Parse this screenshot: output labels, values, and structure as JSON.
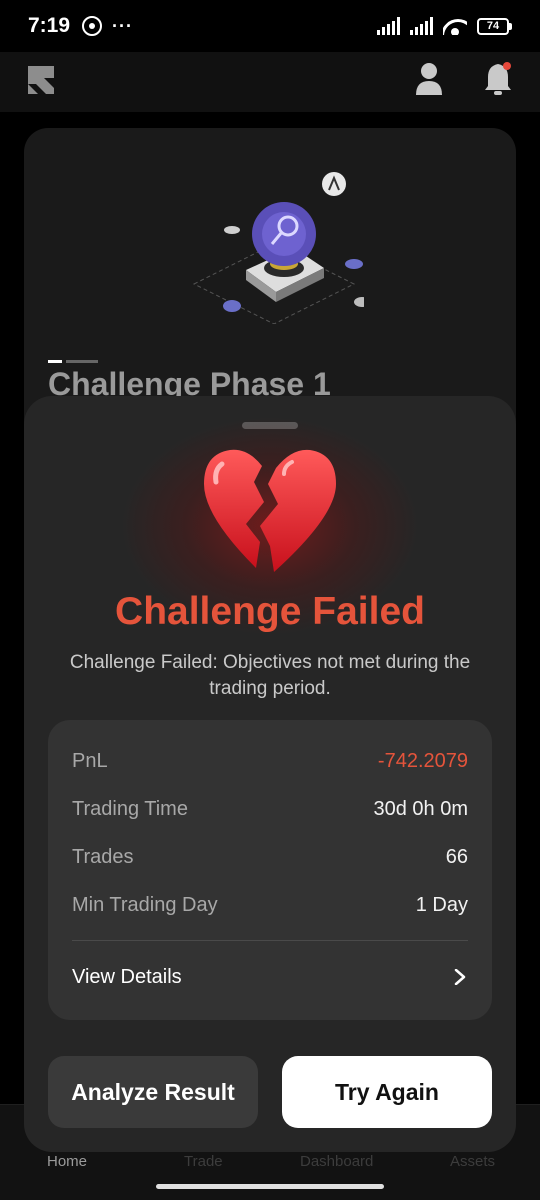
{
  "status_bar": {
    "time": "7:19",
    "more": "···",
    "battery": "74"
  },
  "icons": {
    "logo": "brand-logo",
    "profile": "profile-icon",
    "notifications": "bell-icon",
    "notification_dot_color": "#e5483b"
  },
  "background_card": {
    "title": "Challenge Phase 1"
  },
  "nav": {
    "home": "Home",
    "trade": "Trade",
    "dashboard": "Dashboard",
    "assets": "Assets"
  },
  "sheet": {
    "emoji": "broken-heart-icon",
    "title": "Challenge Failed",
    "description": "Challenge Failed: Objectives not met during the trading period.",
    "stats": [
      {
        "label": "PnL",
        "value": "-742.2079",
        "negative": true
      },
      {
        "label": "Trading Time",
        "value": "30d 0h 0m"
      },
      {
        "label": "Trades",
        "value": "66"
      },
      {
        "label": "Min Trading Day",
        "value": "1 Day"
      }
    ],
    "view_details": "View Details",
    "analyze_button": "Analyze Result",
    "try_again_button": "Try Again"
  },
  "colors": {
    "danger": "#e5543b",
    "sheet_bg": "#262626",
    "card_bg": "#333333"
  }
}
